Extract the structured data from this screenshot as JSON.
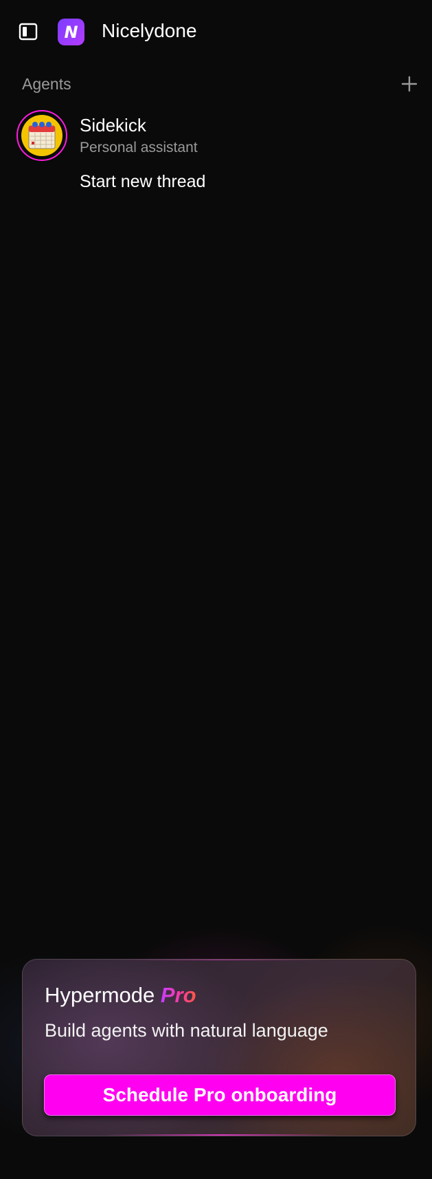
{
  "header": {
    "app_title": "Nicelydone",
    "logo_letter": "N",
    "toggle_icon": "sidebar-toggle-icon"
  },
  "agents_section": {
    "label": "Agents",
    "add_icon": "plus-icon",
    "agents": [
      {
        "name": "Sidekick",
        "subtitle": "Personal assistant",
        "avatar_icon": "calendar-icon",
        "avatar_bg": "#f5c400",
        "ring_color": "#ff1ce0"
      }
    ],
    "new_thread_label": "Start new thread"
  },
  "pro_card": {
    "title": "Hypermode",
    "title_suffix": "Pro",
    "description": "Build agents with natural language",
    "button_label": "Schedule Pro onboarding",
    "button_color": "#ff00f0"
  }
}
